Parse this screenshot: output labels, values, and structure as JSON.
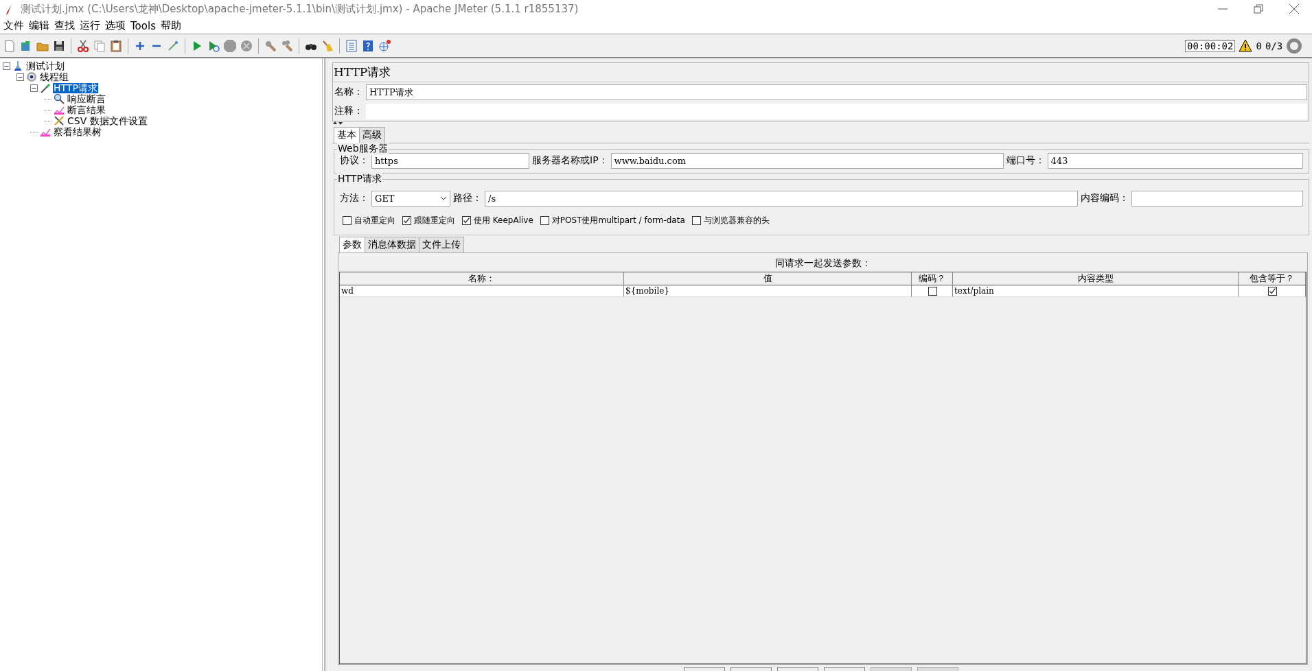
{
  "window": {
    "title": "测试计划.jmx (C:\\Users\\龙神\\Desktop\\apache-jmeter-5.1.1\\bin\\测试计划.jmx) - Apache JMeter (5.1.1 r1855137)"
  },
  "menu": [
    "文件",
    "编辑",
    "查找",
    "运行",
    "选项",
    "Tools",
    "帮助"
  ],
  "status": {
    "timer": "00:00:02",
    "warnings": "0",
    "threads": "0/3"
  },
  "tree": [
    {
      "label": "测试计划",
      "kind": "plan",
      "selected": false,
      "expanded": true,
      "children": [
        {
          "label": "线程组",
          "kind": "thread_group",
          "selected": false,
          "expanded": true,
          "children": [
            {
              "label": "HTTP请求",
              "kind": "sampler",
              "selected": true,
              "expanded": true,
              "children": [
                {
                  "label": "响应断言",
                  "kind": "assertion",
                  "selected": false
                },
                {
                  "label": "断言结果",
                  "kind": "listener",
                  "selected": false
                },
                {
                  "label": "CSV 数据文件设置",
                  "kind": "config",
                  "selected": false
                }
              ]
            },
            {
              "label": "察看结果树",
              "kind": "listener",
              "selected": false
            }
          ]
        }
      ]
    }
  ],
  "panel": {
    "title": "HTTP请求",
    "name_label": "名称：",
    "name_value": "HTTP请求",
    "comment_label": "注释：",
    "tabs": [
      {
        "label": "基本",
        "selected": true
      },
      {
        "label": "高级",
        "selected": false
      }
    ],
    "web_server": {
      "legend": "Web服务器",
      "protocol_label": "协议：",
      "protocol": "https",
      "server_label": "服务器名称或IP：",
      "server": "www.baidu.com",
      "port_label": "端口号：",
      "port": "443"
    },
    "http_request": {
      "legend": "HTTP请求",
      "method_label": "方法：",
      "method": "GET",
      "path_label": "路径：",
      "path": "/s",
      "encoding_label": "内容编码："
    },
    "options": [
      {
        "label": "自动重定向",
        "checked": false
      },
      {
        "label": "跟随重定向",
        "checked": true
      },
      {
        "label": "使用 KeepAlive",
        "checked": true
      },
      {
        "label": "对POST使用multipart / form-data",
        "checked": false
      },
      {
        "label": "与浏览器兼容的头",
        "checked": false
      }
    ],
    "param_tabs": [
      {
        "label": "参数",
        "selected": true
      },
      {
        "label": "消息体数据",
        "selected": false
      },
      {
        "label": "文件上传",
        "selected": false
      }
    ],
    "params": {
      "caption": "同请求一起发送参数：",
      "columns": [
        "名称：",
        "值",
        "编码？",
        "内容类型",
        "包含等于？"
      ],
      "rows": [
        {
          "name": "wd",
          "value": "${mobile}",
          "encode": false,
          "content_type": "text/plain",
          "include_equals": true
        }
      ]
    },
    "bottom_buttons": [
      {
        "disabled": false
      },
      {
        "disabled": false
      },
      {
        "disabled": false
      },
      {
        "disabled": false
      },
      {
        "disabled": true
      },
      {
        "disabled": true
      }
    ]
  }
}
